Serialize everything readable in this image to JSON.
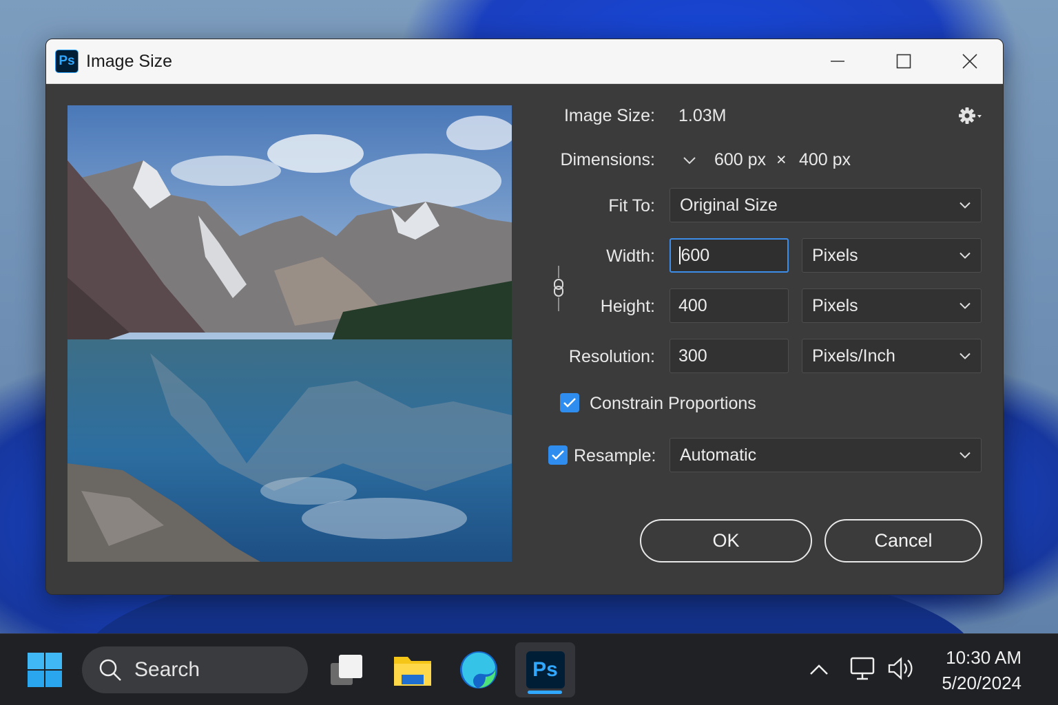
{
  "window": {
    "title": "Image Size",
    "app_badge": "Ps"
  },
  "dialog": {
    "image_size_label": "Image Size:",
    "image_size_value": "1.03M",
    "dimensions_label": "Dimensions:",
    "dim_width": "600 px",
    "dim_times": "×",
    "dim_height": "400 px",
    "fit_to_label": "Fit To:",
    "fit_to_value": "Original Size",
    "width_label": "Width:",
    "width_value": "600",
    "width_unit": "Pixels",
    "height_label": "Height:",
    "height_value": "400",
    "height_unit": "Pixels",
    "resolution_label": "Resolution:",
    "resolution_value": "300",
    "resolution_unit": "Pixels/Inch",
    "constrain_label": "Constrain Proportions",
    "constrain_checked": true,
    "resample_label": "Resample:",
    "resample_checked": true,
    "resample_value": "Automatic",
    "ok_label": "OK",
    "cancel_label": "Cancel"
  },
  "taskbar": {
    "search_placeholder": "Search",
    "ps_badge": "Ps",
    "time": "10:30 AM",
    "date": "5/20/2024"
  },
  "colors": {
    "accent": "#2f8df0",
    "ps_blue": "#31a8ff",
    "ps_dark": "#001e36"
  }
}
